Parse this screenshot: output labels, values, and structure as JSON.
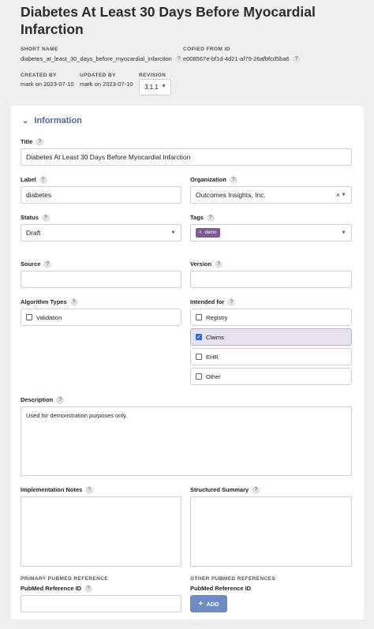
{
  "header": {
    "title": "Diabetes At Least 30 Days Before Myocardial Infarction",
    "short_name_label": "SHORT NAME",
    "short_name": "diabetes_at_least_30_days_before_myocardial_infarction",
    "copied_from_label": "COPIED FROM ID",
    "copied_from": "e008567e-bf1d-4d21-af79-26afbfcd5ba6",
    "created_by_label": "CREATED BY",
    "created_by": "mark on 2023-07-10",
    "updated_by_label": "UPDATED BY",
    "updated_by": "mark on 2023-07-10",
    "revision_label": "REVISION",
    "revision": "3.1.1"
  },
  "help_glyph": "?",
  "section": {
    "title": "Information"
  },
  "form": {
    "title_label": "Title",
    "title_value": "Diabetes At Least 30 Days Before Myocardial Infarction",
    "label_label": "Label",
    "label_value": "diabetes",
    "organization_label": "Organization",
    "organization_value": "Outcomes Insights, Inc.",
    "status_label": "Status",
    "status_value": "Draft",
    "tags_label": "Tags",
    "tags": [
      "demo"
    ],
    "source_label": "Source",
    "source_value": "",
    "version_label": "Version",
    "version_value": "",
    "algorithm_types_label": "Algorithm Types",
    "algorithm_types": [
      {
        "label": "Validation",
        "checked": false
      }
    ],
    "intended_for_label": "Intended for",
    "intended_for": [
      {
        "label": "Registry",
        "checked": false
      },
      {
        "label": "Claims",
        "checked": true
      },
      {
        "label": "EHR",
        "checked": false
      },
      {
        "label": "Other",
        "checked": false
      }
    ],
    "description_label": "Description",
    "description_value": "Used for demonstration purposes only.",
    "implementation_notes_label": "Implementation Notes",
    "implementation_notes_value": "",
    "structured_summary_label": "Structured Summary",
    "structured_summary_value": "",
    "primary_pubmed_heading": "PRIMARY PUBMED REFERENCE",
    "pubmed_id_label": "PubMed Reference ID",
    "pubmed_id_value": "",
    "other_pubmed_heading": "OTHER PUBMED REFERENCES",
    "other_pubmed_label": "PubMed Reference ID",
    "add_button": "ADD"
  },
  "colors": {
    "accent": "#4d66a8",
    "tag": "#7d5b95",
    "checkbox_checked": "#2f6fd8",
    "button": "#6e8cc4"
  },
  "icons": {
    "section_toggle": "chevron-down-icon",
    "select_caret": "caret-down-icon",
    "clear": "close-icon",
    "add": "plus-icon"
  }
}
